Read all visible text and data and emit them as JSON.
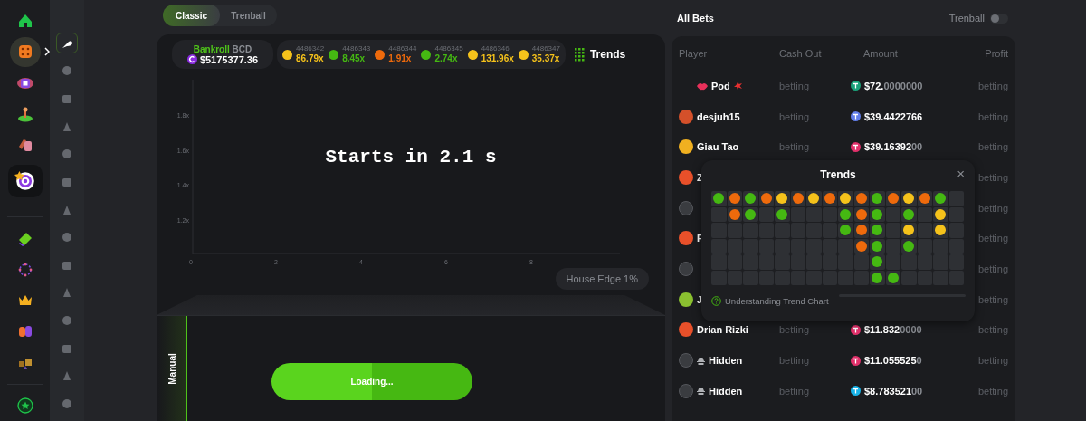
{
  "nav": [
    {
      "selected": false,
      "hovered": false
    },
    {
      "selected": false,
      "hovered": true
    },
    {
      "selected": false,
      "hovered": false
    },
    {
      "selected": false,
      "hovered": false
    },
    {
      "selected": false,
      "hovered": false
    },
    {
      "selected": true,
      "hovered": false
    },
    {
      "selected": false,
      "hovered": false
    },
    {
      "selected": false,
      "hovered": false
    },
    {
      "selected": false,
      "hovered": false
    },
    {
      "selected": false,
      "hovered": false
    },
    {
      "selected": false,
      "hovered": false
    },
    {
      "selected": false,
      "hovered": false
    }
  ],
  "game_nav": [
    {
      "selected": true
    },
    {
      "selected": false
    },
    {
      "selected": false
    },
    {
      "selected": false
    },
    {
      "selected": false
    },
    {
      "selected": false
    },
    {
      "selected": false
    },
    {
      "selected": false
    },
    {
      "selected": false
    },
    {
      "selected": false
    },
    {
      "selected": false
    },
    {
      "selected": false
    },
    {
      "selected": false
    },
    {
      "selected": false
    }
  ],
  "tabs": [
    {
      "label": "Classic",
      "selected": true
    },
    {
      "label": "Trenball",
      "selected": false
    }
  ],
  "bankroll": {
    "label": "Bankroll",
    "currency": "BCD",
    "value": "$5175377.36"
  },
  "history": [
    {
      "id": "4486342",
      "value": "86.79x",
      "color": "#f5c21b"
    },
    {
      "id": "4486343",
      "value": "8.45x",
      "color": "#45b812"
    },
    {
      "id": "4486344",
      "value": "1.91x",
      "color": "#ee6a0c"
    },
    {
      "id": "4486345",
      "value": "2.74x",
      "color": "#45b812"
    },
    {
      "id": "4486346",
      "value": "131.96x",
      "color": "#f5c21b"
    },
    {
      "id": "4486347",
      "value": "35.37x",
      "color": "#f5c21b"
    }
  ],
  "trends_button": "Trends",
  "chart": {
    "y_ticks": [
      "1.8x",
      "1.6x",
      "1.4x",
      "1.2x"
    ],
    "x_ticks": [
      "0",
      "2",
      "4",
      "6",
      "8"
    ]
  },
  "countdown": "Starts in 2.1 s",
  "house_edge": "House Edge 1%",
  "mode_tab": {
    "label": "Manual",
    "selected": true
  },
  "bet_button": "Loading...",
  "bets": {
    "title": "All Bets",
    "toggle": {
      "label": "Trenball",
      "on": false
    },
    "columns": [
      "Player",
      "Cash Out",
      "Amount",
      "Profit"
    ],
    "rows": [
      {
        "kind": "pod",
        "name": "Pod",
        "cash_out": "betting",
        "amount": "$72.",
        "amount_tail": "0000000",
        "coin": {
          "color": "#1ba27a"
        },
        "profit": "betting"
      },
      {
        "kind": "user",
        "avatar": {
          "color": "#d4502a"
        },
        "name": "desjuh15",
        "cash_out": "betting",
        "amount": "$39.4422766",
        "coin": {
          "color": "#627eea"
        },
        "profit": "betting"
      },
      {
        "kind": "user",
        "avatar": {
          "color": "#f0b020"
        },
        "name": "Giau Tao",
        "cash_out": "betting",
        "amount": "$39.16392",
        "amount_tail": "00",
        "coin": {
          "color": "#e0306a"
        },
        "profit": "betting"
      },
      {
        "kind": "user",
        "avatar": {
          "color": "#e8502a"
        },
        "name": "Z",
        "profit": "betting"
      },
      {
        "kind": "hidden",
        "profit": "betting"
      },
      {
        "kind": "user",
        "avatar": {
          "color": "#e8502a"
        },
        "name": "F",
        "profit": "betting"
      },
      {
        "kind": "hidden",
        "profit": "betting"
      },
      {
        "kind": "user",
        "avatar": {
          "color": "#8ac030"
        },
        "name": "J",
        "profit": "betting"
      },
      {
        "kind": "user",
        "avatar": {
          "color": "#e8502a"
        },
        "name": "Drian Rizki",
        "cash_out": "betting",
        "amount": "$11.832",
        "amount_tail": "0000",
        "coin": {
          "color": "#e0306a"
        },
        "profit": "betting"
      },
      {
        "kind": "hidden",
        "name": "Hidden",
        "cash_out": "betting",
        "amount": "$11.055525",
        "amount_tail": "0",
        "coin": {
          "color": "#e0306a"
        },
        "profit": "betting"
      },
      {
        "kind": "hidden",
        "name": "Hidden",
        "cash_out": "betting",
        "amount": "$8.783521",
        "amount_tail": "00",
        "coin": {
          "color": "#18b3e8"
        },
        "profit": "betting"
      }
    ]
  },
  "trends_popup": {
    "title": "Trends",
    "close": "×",
    "help": "Understanding Trend Chart",
    "grid": [
      [
        {
          "kind": "dot",
          "color": "#45b812"
        },
        {
          "kind": "dot",
          "color": "#ee6a0c"
        },
        {
          "kind": "dot",
          "color": "#45b812"
        },
        {
          "kind": "dot",
          "color": "#ee6a0c"
        },
        {
          "kind": "dot",
          "color": "#f5c21b"
        },
        {
          "kind": "dot",
          "color": "#ee6a0c"
        },
        {
          "kind": "dot",
          "color": "#f5c21b"
        },
        {
          "kind": "dot",
          "color": "#ee6a0c"
        },
        {
          "kind": "dot",
          "color": "#f5c21b"
        },
        {
          "kind": "dot",
          "color": "#ee6a0c"
        },
        {
          "kind": "dot",
          "color": "#45b812"
        },
        {
          "kind": "dot",
          "color": "#ee6a0c"
        },
        {
          "kind": "dot",
          "color": "#f5c21b"
        },
        {
          "kind": "dot",
          "color": "#ee6a0c"
        },
        {
          "kind": "dot",
          "color": "#45b812"
        },
        {
          "kind": "empty"
        }
      ],
      [
        {
          "kind": "empty"
        },
        {
          "kind": "dot",
          "color": "#ee6a0c"
        },
        {
          "kind": "dot",
          "color": "#45b812"
        },
        {
          "kind": "empty"
        },
        {
          "kind": "dot",
          "color": "#45b812"
        },
        {
          "kind": "empty"
        },
        {
          "kind": "empty"
        },
        {
          "kind": "empty"
        },
        {
          "kind": "dot",
          "color": "#45b812"
        },
        {
          "kind": "dot",
          "color": "#ee6a0c"
        },
        {
          "kind": "dot",
          "color": "#45b812"
        },
        {
          "kind": "empty"
        },
        {
          "kind": "dot",
          "color": "#45b812"
        },
        {
          "kind": "empty"
        },
        {
          "kind": "dot",
          "color": "#f5c21b"
        },
        {
          "kind": "empty"
        }
      ],
      [
        {
          "kind": "empty"
        },
        {
          "kind": "empty"
        },
        {
          "kind": "empty"
        },
        {
          "kind": "empty"
        },
        {
          "kind": "empty"
        },
        {
          "kind": "empty"
        },
        {
          "kind": "empty"
        },
        {
          "kind": "empty"
        },
        {
          "kind": "dot",
          "color": "#45b812"
        },
        {
          "kind": "dot",
          "color": "#ee6a0c"
        },
        {
          "kind": "dot",
          "color": "#45b812"
        },
        {
          "kind": "empty"
        },
        {
          "kind": "dot",
          "color": "#f5c21b"
        },
        {
          "kind": "empty"
        },
        {
          "kind": "dot",
          "color": "#f5c21b"
        },
        {
          "kind": "empty"
        }
      ],
      [
        {
          "kind": "empty"
        },
        {
          "kind": "empty"
        },
        {
          "kind": "empty"
        },
        {
          "kind": "empty"
        },
        {
          "kind": "empty"
        },
        {
          "kind": "empty"
        },
        {
          "kind": "empty"
        },
        {
          "kind": "empty"
        },
        {
          "kind": "empty"
        },
        {
          "kind": "dot",
          "color": "#ee6a0c"
        },
        {
          "kind": "dot",
          "color": "#45b812"
        },
        {
          "kind": "empty"
        },
        {
          "kind": "dot",
          "color": "#45b812"
        },
        {
          "kind": "empty"
        },
        {
          "kind": "empty"
        },
        {
          "kind": "empty"
        }
      ],
      [
        {
          "kind": "empty"
        },
        {
          "kind": "empty"
        },
        {
          "kind": "empty"
        },
        {
          "kind": "empty"
        },
        {
          "kind": "empty"
        },
        {
          "kind": "empty"
        },
        {
          "kind": "empty"
        },
        {
          "kind": "empty"
        },
        {
          "kind": "empty"
        },
        {
          "kind": "empty"
        },
        {
          "kind": "dot",
          "color": "#45b812"
        },
        {
          "kind": "empty"
        },
        {
          "kind": "empty"
        },
        {
          "kind": "empty"
        },
        {
          "kind": "empty"
        },
        {
          "kind": "empty"
        }
      ],
      [
        {
          "kind": "empty"
        },
        {
          "kind": "empty"
        },
        {
          "kind": "empty"
        },
        {
          "kind": "empty"
        },
        {
          "kind": "empty"
        },
        {
          "kind": "empty"
        },
        {
          "kind": "empty"
        },
        {
          "kind": "empty"
        },
        {
          "kind": "empty"
        },
        {
          "kind": "empty"
        },
        {
          "kind": "dot",
          "color": "#45b812"
        },
        {
          "kind": "dot",
          "color": "#45b812"
        },
        {
          "kind": "empty"
        },
        {
          "kind": "empty"
        },
        {
          "kind": "empty"
        },
        {
          "kind": "empty"
        }
      ]
    ]
  }
}
